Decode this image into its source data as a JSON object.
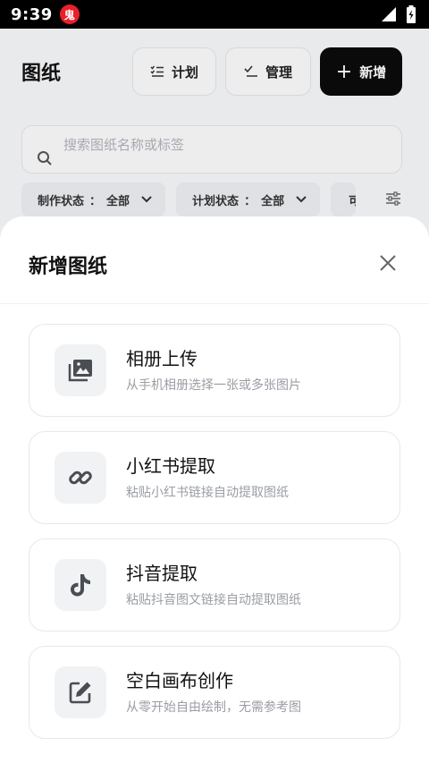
{
  "status_bar": {
    "time": "9:39",
    "app_badge": "鬼"
  },
  "header": {
    "title": "图纸",
    "plan_label": "计划",
    "manage_label": "管理",
    "add_label": "新增"
  },
  "search": {
    "placeholder": "搜索图纸名称或标签"
  },
  "filters": [
    {
      "label": "制作状态",
      "value": "全部"
    },
    {
      "label": "计划状态",
      "value": "全部"
    },
    {
      "label": "可"
    }
  ],
  "sheet": {
    "title": "新增图纸",
    "options": [
      {
        "title": "相册上传",
        "desc": "从手机相册选择一张或多张图片",
        "icon": "photo-library-icon"
      },
      {
        "title": "小红书提取",
        "desc": "粘贴小红书链接自动提取图纸",
        "icon": "link-icon"
      },
      {
        "title": "抖音提取",
        "desc": "粘贴抖音图文链接自动提取图纸",
        "icon": "tiktok-icon"
      },
      {
        "title": "空白画布创作",
        "desc": "从零开始自由绘制，无需参考图",
        "icon": "edit-icon"
      }
    ]
  },
  "colors": {
    "accent": "#0b0b0b",
    "icon": "#4a4d53",
    "muted": "#9a9da3"
  }
}
